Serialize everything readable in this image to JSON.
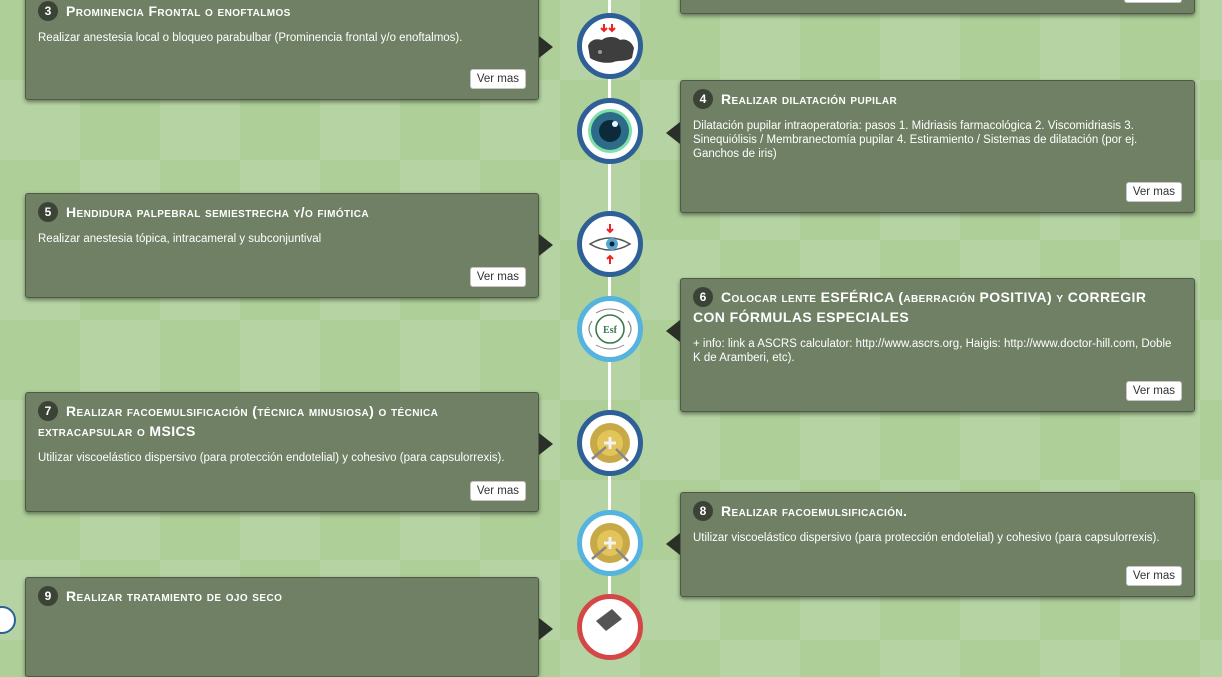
{
  "steps": [
    {
      "num": "3",
      "title": "Prominencia Frontal o enoftalmos",
      "desc": "Realizar anestesia local o bloqueo parabulbar (Prominencia frontal y/o enoftalmos).",
      "more": "Ver mas",
      "icon": "head-pressure-icon"
    },
    {
      "num": "4",
      "title": "Realizar dilatación pupilar",
      "desc": "Dilatación pupilar intraoperatoria: pasos 1. Midriasis farmacológica 2. Viscomidriasis 3. Sinequiólisis / Membranectomía pupilar 4. Estiramiento / Sistemas de dilatación (por ej. Ganchos de iris)",
      "more": "Ver mas",
      "icon": "pupil-icon"
    },
    {
      "num": "5",
      "title": "Hendidura palpebral semiestrecha y/o fimótica",
      "desc": "Realizar anestesia tópica, intracameral y subconjuntival",
      "more": "Ver mas",
      "icon": "eye-narrow-icon"
    },
    {
      "num": "6",
      "title": "Colocar lente ESFÉRICA (aberración POSITIVA) y CORREGIR CON FÓRMULAS ESPECIALES",
      "desc": "+ info: link a ASCRS calculator: http://www.ascrs.org, Haigis: http://www.doctor-hill.com, Doble K de Aramberi, etc).",
      "more": "Ver mas",
      "icon": "spherical-lens-icon",
      "icon_text": "Esf"
    },
    {
      "num": "7",
      "title": "Realizar facoemulsificación (técnica minusiosa) o técnica extracapsular o MSICS",
      "desc": "Utilizar viscoelástico dispersivo (para protección endotelial) y cohesivo (para capsulorrexis).",
      "more": "Ver mas",
      "icon": "phaco-icon"
    },
    {
      "num": "8",
      "title": "Realizar facoemulsificación.",
      "desc": "Utilizar viscoelástico dispersivo (para protección endotelial) y cohesivo (para capsulorrexis).",
      "more": "Ver mas",
      "icon": "phaco-icon"
    },
    {
      "num": "9",
      "title": "Realizar tratamiento de ojo seco",
      "desc": "",
      "more": "",
      "icon": "dry-eye-icon"
    }
  ],
  "colors": {
    "background": "#aecf98",
    "card": "#6f8064",
    "marker_dark_blue": "#2e5f96",
    "marker_light_blue": "#56b3de",
    "marker_red": "#d44747"
  }
}
